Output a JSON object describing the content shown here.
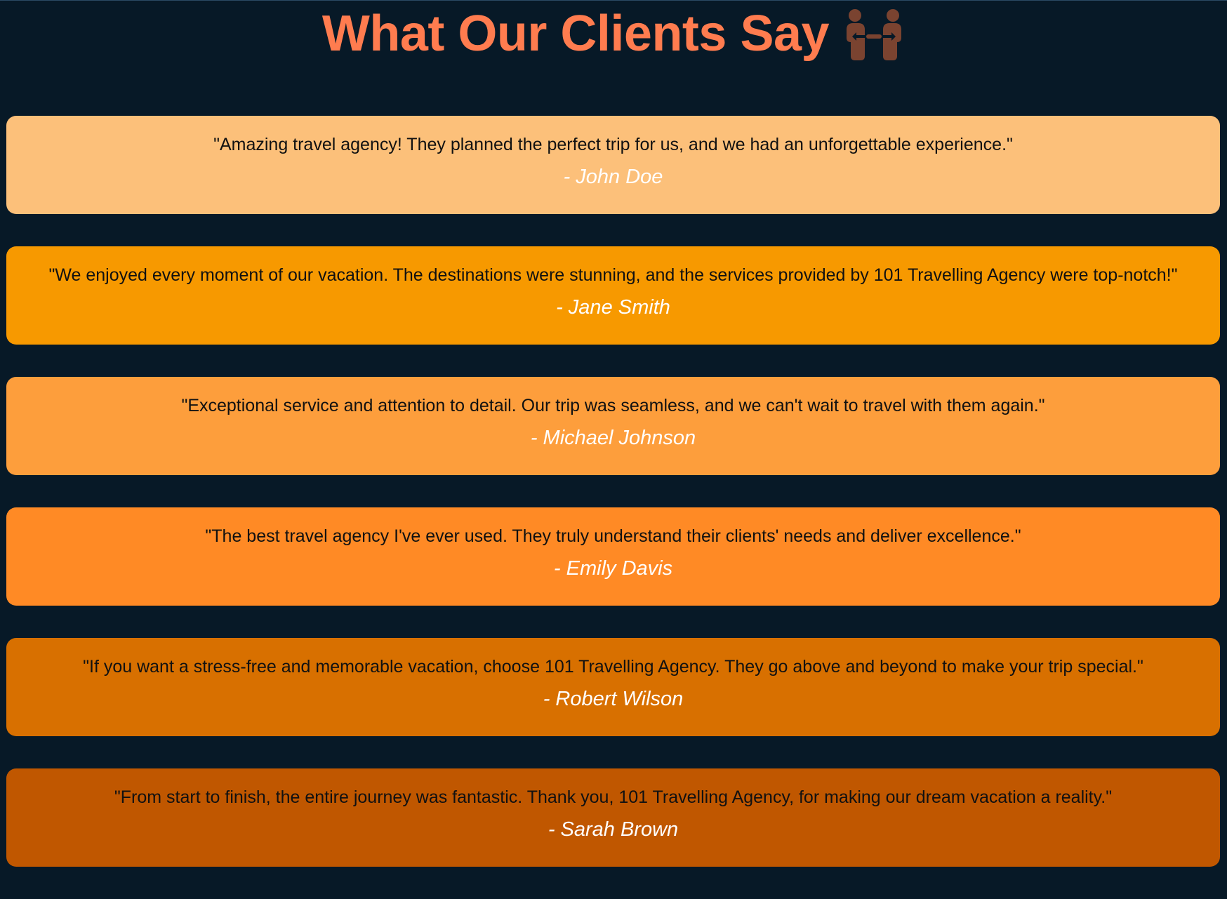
{
  "page": {
    "background": "#071927",
    "title": "What Our Clients Say",
    "title_color": "#ff7c4f",
    "title_icon": "people-handshake-icon",
    "icon_color": "#7a4330"
  },
  "testimonials": [
    {
      "quote": "\"Amazing travel agency! They planned the perfect trip for us, and we had an unforgettable experience.\"",
      "author": "- John Doe",
      "color": "#fcc07a"
    },
    {
      "quote": "\"We enjoyed every moment of our vacation. The destinations were stunning, and the services provided by 101 Travelling Agency were top-notch!\"",
      "author": "- Jane Smith",
      "color": "#f79900"
    },
    {
      "quote": "\"Exceptional service and attention to detail. Our trip was seamless, and we can't wait to travel with them again.\"",
      "author": "- Michael Johnson",
      "color": "#fd9e3c"
    },
    {
      "quote": "\"The best travel agency I've ever used. They truly understand their clients' needs and deliver excellence.\"",
      "author": "- Emily Davis",
      "color": "#ff8a25"
    },
    {
      "quote": "\"If you want a stress-free and memorable vacation, choose 101 Travelling Agency. They go above and beyond to make your trip special.\"",
      "author": "- Robert Wilson",
      "color": "#d87000"
    },
    {
      "quote": "\"From start to finish, the entire journey was fantastic. Thank you, 101 Travelling Agency, for making our dream vacation a reality.\"",
      "author": "- Sarah Brown",
      "color": "#c05700"
    }
  ]
}
